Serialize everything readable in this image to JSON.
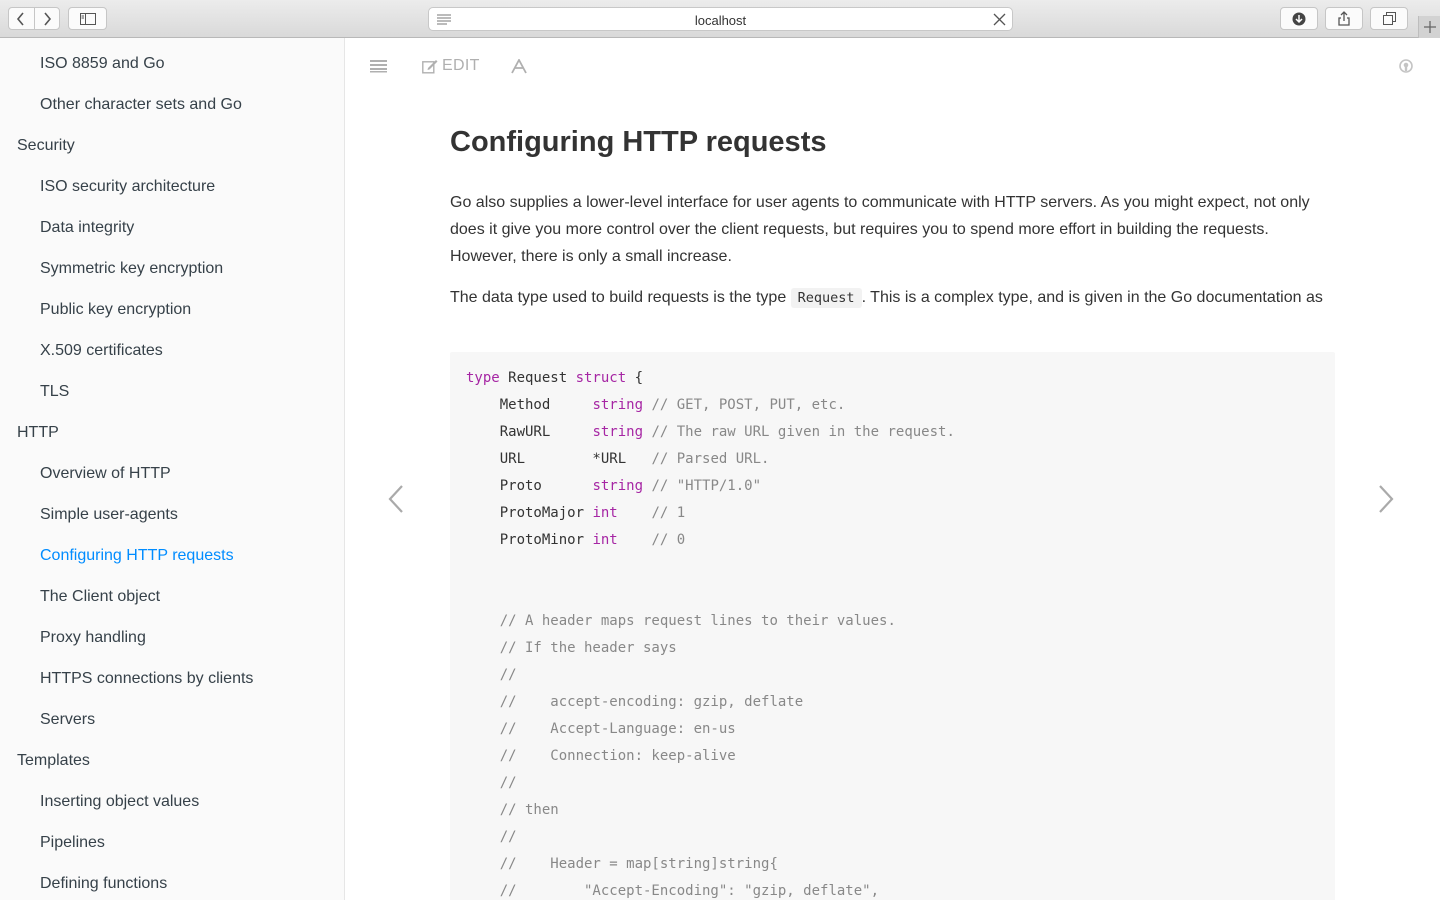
{
  "browser": {
    "url": "localhost"
  },
  "sidebar": {
    "items": [
      {
        "label": "ISO 8859 and Go",
        "level": 2
      },
      {
        "label": "Other character sets and Go",
        "level": 2
      },
      {
        "label": "Security",
        "level": 1
      },
      {
        "label": "ISO security architecture",
        "level": 2
      },
      {
        "label": "Data integrity",
        "level": 2
      },
      {
        "label": "Symmetric key encryption",
        "level": 2
      },
      {
        "label": "Public key encryption",
        "level": 2
      },
      {
        "label": "X.509 certificates",
        "level": 2
      },
      {
        "label": "TLS",
        "level": 2
      },
      {
        "label": "HTTP",
        "level": 1
      },
      {
        "label": "Overview of HTTP",
        "level": 2
      },
      {
        "label": "Simple user-agents",
        "level": 2
      },
      {
        "label": "Configuring HTTP requests",
        "level": 2,
        "active": true
      },
      {
        "label": "The Client object",
        "level": 2
      },
      {
        "label": "Proxy handling",
        "level": 2
      },
      {
        "label": "HTTPS connections by clients",
        "level": 2
      },
      {
        "label": "Servers",
        "level": 2
      },
      {
        "label": "Templates",
        "level": 1
      },
      {
        "label": "Inserting object values",
        "level": 2
      },
      {
        "label": "Pipelines",
        "level": 2
      },
      {
        "label": "Defining functions",
        "level": 2
      }
    ],
    "active_color": "#008cff"
  },
  "toolbar": {
    "edit_label": "EDIT",
    "icons": [
      "menu-icon",
      "edit-icon",
      "font-icon",
      "github-icon"
    ]
  },
  "content": {
    "title": "Configuring HTTP requests",
    "para1": "Go also supplies a lower-level interface for user agents to communicate with HTTP servers. As you might expect, not only does it give you more control over the client requests, but requires you to spend more effort in building the requests. However, there is only a small increase.",
    "para2_before": "The data type used to build requests is the type ",
    "para2_code": "Request",
    "para2_after": ". This is a complex type, and is given in the Go documentation as",
    "code_lines": [
      "type Request struct {",
      "    Method     string // GET, POST, PUT, etc.",
      "    RawURL     string // The raw URL given in the request.",
      "    URL        *URL   // Parsed URL.",
      "    Proto      string // \"HTTP/1.0\"",
      "    ProtoMajor int    // 1",
      "    ProtoMinor int    // 0",
      "",
      "",
      "    // A header maps request lines to their values.",
      "    // If the header says",
      "    //",
      "    //    accept-encoding: gzip, deflate",
      "    //    Accept-Language: en-us",
      "    //    Connection: keep-alive",
      "    //",
      "    // then",
      "    //",
      "    //    Header = map[string]string{",
      "    //        \"Accept-Encoding\": \"gzip, deflate\","
    ]
  }
}
